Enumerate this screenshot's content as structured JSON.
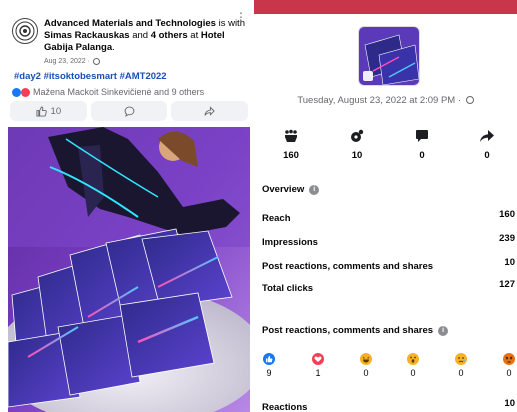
{
  "post": {
    "author": "Advanced Materials and Technologies",
    "is_with_text": " is with ",
    "tagged_person": "Simas Rackauskas",
    "and_text": " and ",
    "others": "4 others",
    "at_text": " at ",
    "location": "Hotel Gabija Palanga",
    "period": ".",
    "date": "Aug 23, 2022 ·",
    "hashtags": "#day2 #itsoktobesmart #AMT2022",
    "reactors": "Mažena Mackoit Sinkevičienė and 9 others",
    "like_count": "10",
    "icons": {
      "avatar": "amt-logo-icon",
      "more": "more-options-icon",
      "like": "like-icon",
      "comment": "comment-icon",
      "share": "share-icon",
      "privacy": "globe-icon"
    }
  },
  "insights": {
    "datetime": "Tuesday, August 23, 2022 at 2:09 PM ·",
    "stats": [
      {
        "icon": "reach-crowd-icon",
        "value": "160"
      },
      {
        "icon": "engagement-icon",
        "value": "10"
      },
      {
        "icon": "comment-bubble-icon",
        "value": "0"
      },
      {
        "icon": "share-arrow-icon",
        "value": "0"
      }
    ],
    "overview_title": "Overview",
    "metrics": [
      {
        "label": "Reach",
        "value": "160"
      },
      {
        "label": "Impressions",
        "value": "239"
      },
      {
        "label": "Post reactions, comments and shares",
        "value": "10"
      },
      {
        "label": "Total clicks",
        "value": "127"
      }
    ],
    "breakdown_title": "Post reactions, comments and shares",
    "reactions": [
      {
        "icon": "like-reaction-icon",
        "value": "9",
        "color": "#1877f2"
      },
      {
        "icon": "love-reaction-icon",
        "value": "1",
        "color": "#f33e58"
      },
      {
        "icon": "haha-reaction-icon",
        "value": "0",
        "color": "#f7b125"
      },
      {
        "icon": "wow-reaction-icon",
        "value": "0",
        "color": "#f7b125"
      },
      {
        "icon": "sad-reaction-icon",
        "value": "0",
        "color": "#f7b125"
      },
      {
        "icon": "angry-reaction-icon",
        "value": "0",
        "color": "#e9710f"
      }
    ],
    "reactions_label": "Reactions",
    "reactions_total": "10"
  },
  "colors": {
    "accent_bar": "#c8364b",
    "link_blue": "#1a4fb5",
    "muted": "#65676b"
  }
}
